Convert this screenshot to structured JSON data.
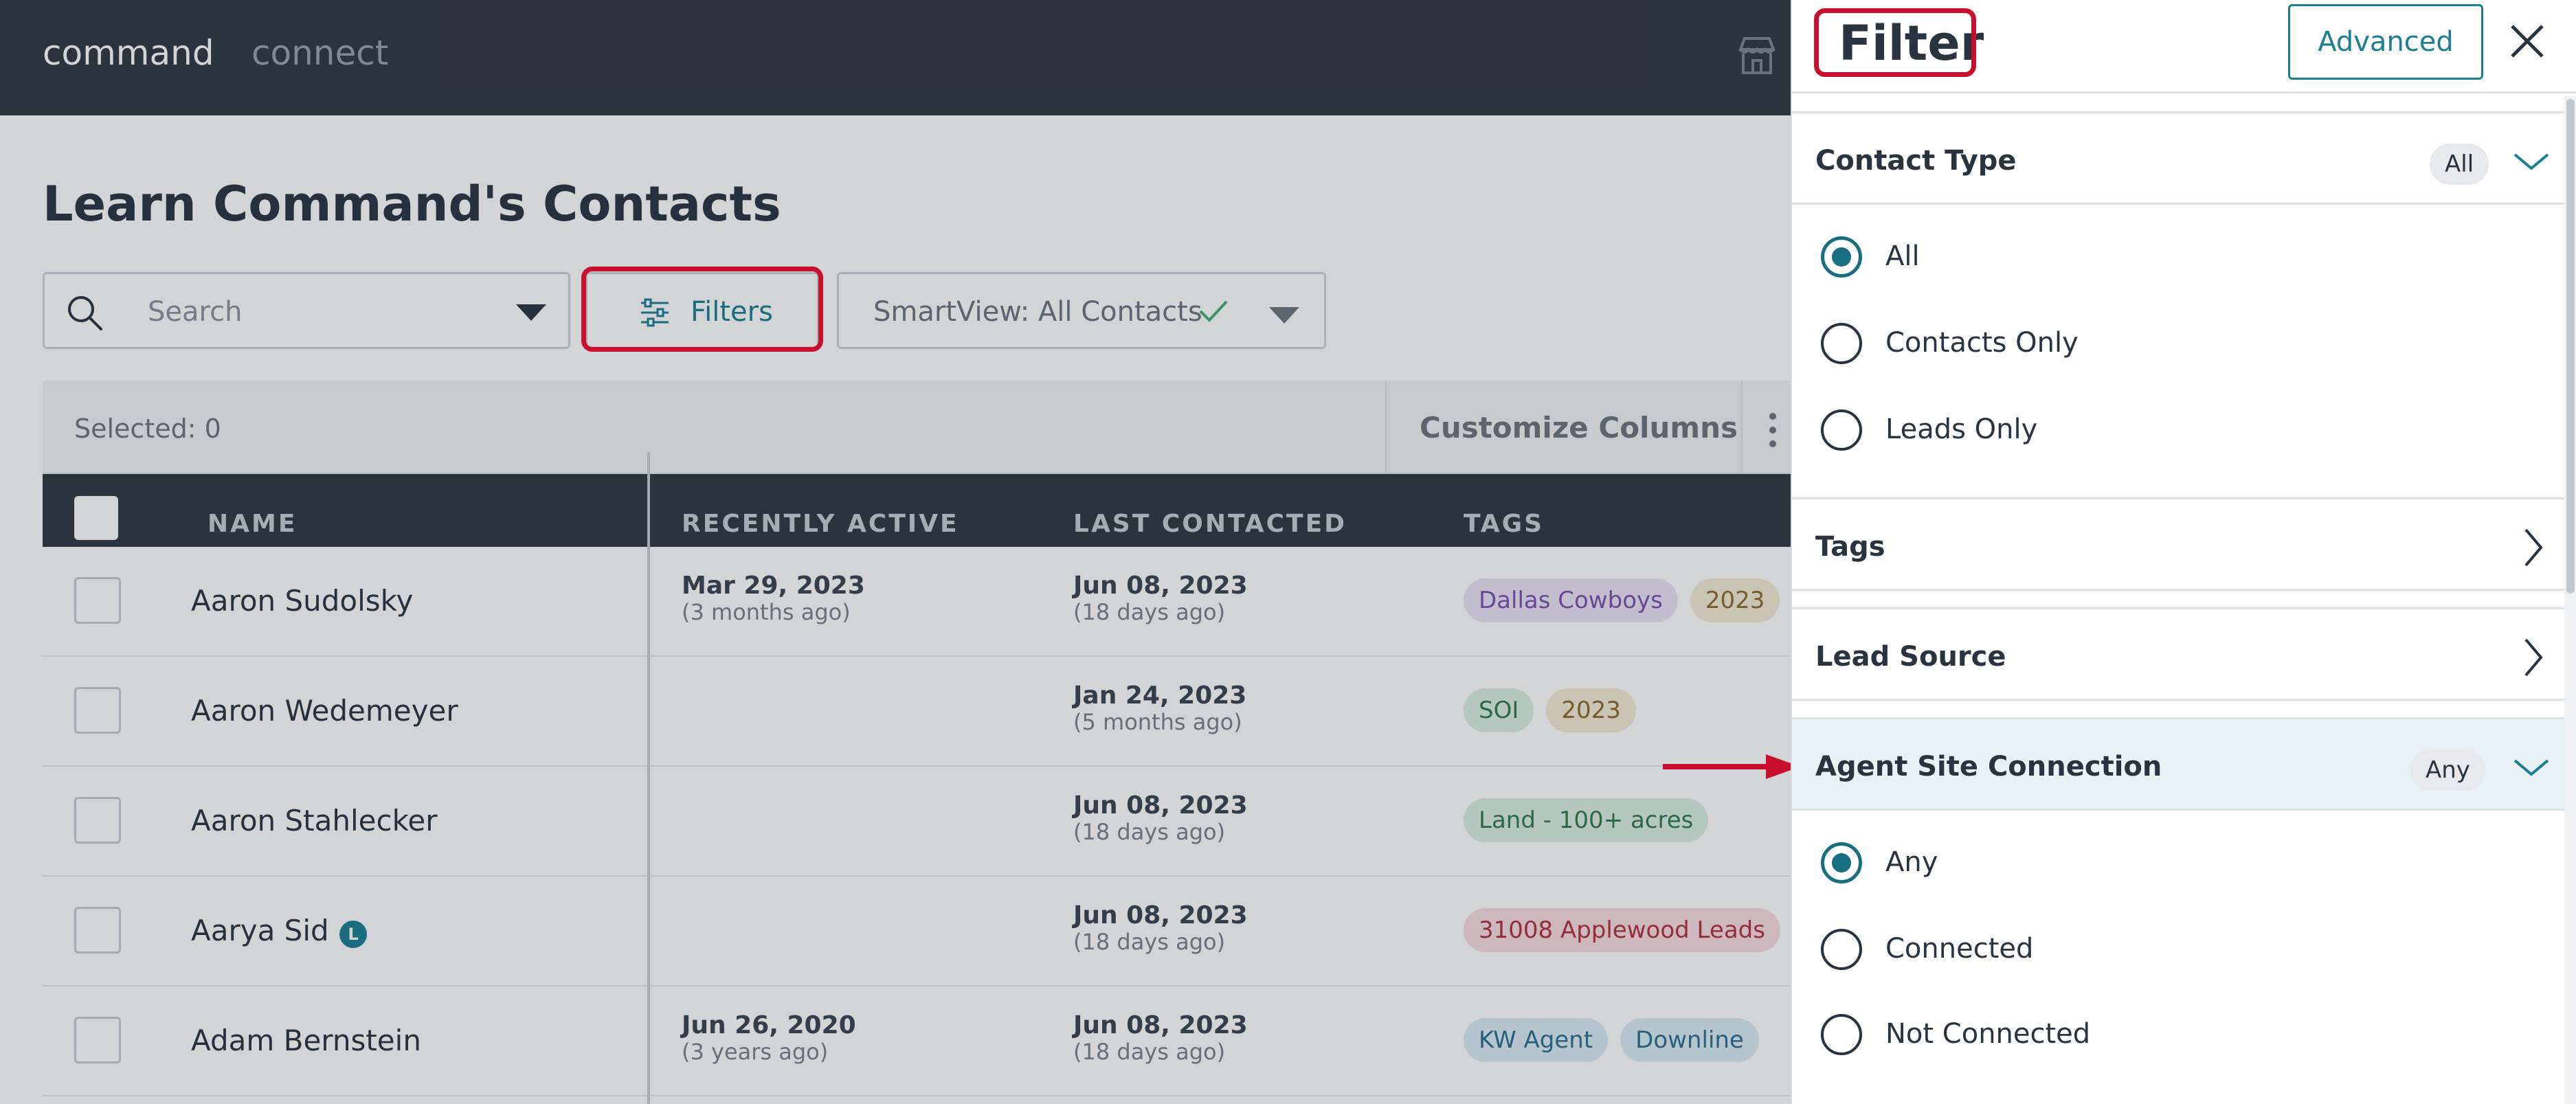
{
  "app": {
    "nav": {
      "command": "command",
      "connect": "connect"
    },
    "page_title": "Learn Command's Contacts",
    "search": {
      "placeholder": "Search"
    },
    "filters_button": "Filters",
    "smartview": "SmartView: All Contacts",
    "selected": "Selected: 0",
    "customize_columns": "Customize Columns",
    "columns": [
      "NAME",
      "RECENTLY ACTIVE",
      "LAST CONTACTED",
      "TAGS"
    ],
    "rows": [
      {
        "name": "Aaron Sudolsky",
        "lead": "",
        "recent_date": "Mar 29, 2023",
        "recent_ago": "(3 months ago)",
        "last_date": "Jun 08, 2023",
        "last_ago": "(18 days ago)",
        "tags": [
          {
            "text": "Dallas Cowboys",
            "bg": "#ece4f6",
            "fg": "#7b4fb0"
          },
          {
            "text": "2023",
            "bg": "#f6ecd6",
            "fg": "#8a6a2a"
          }
        ]
      },
      {
        "name": "Aaron Wedemeyer",
        "lead": "",
        "recent_date": "",
        "recent_ago": "",
        "last_date": "Jan 24, 2023",
        "last_ago": "(5 months ago)",
        "tags": [
          {
            "text": "SOI",
            "bg": "#dcefe3",
            "fg": "#2f7a4a"
          },
          {
            "text": "2023",
            "bg": "#f6ecd6",
            "fg": "#8a6a2a"
          }
        ]
      },
      {
        "name": "Aaron Stahlecker",
        "lead": "",
        "recent_date": "",
        "recent_ago": "",
        "last_date": "Jun 08, 2023",
        "last_ago": "(18 days ago)",
        "tags": [
          {
            "text": "Land - 100+ acres",
            "bg": "#dcefe3",
            "fg": "#2f7a4a"
          }
        ]
      },
      {
        "name": "Aarya Sid",
        "lead": "L",
        "recent_date": "",
        "recent_ago": "",
        "last_date": "Jun 08, 2023",
        "last_ago": "(18 days ago)",
        "tags": [
          {
            "text": "31008 Applewood Leads",
            "bg": "#f8dde0",
            "fg": "#b3303d"
          }
        ]
      },
      {
        "name": "Adam Bernstein",
        "lead": "",
        "recent_date": "Jun 26, 2020",
        "recent_ago": "(3 years ago)",
        "last_date": "Jun 08, 2023",
        "last_ago": "(18 days ago)",
        "tags": [
          {
            "text": "KW Agent",
            "bg": "#dcecf4",
            "fg": "#2a6f8e"
          },
          {
            "text": "Downline",
            "bg": "#dcecf4",
            "fg": "#2a6f8e"
          }
        ]
      }
    ]
  },
  "filter_panel": {
    "title": "Filter",
    "advanced": "Advanced",
    "sections": {
      "contact_type": {
        "title": "Contact Type",
        "badge": "All",
        "options": [
          "All",
          "Contacts Only",
          "Leads Only"
        ],
        "selected": 0
      },
      "tags": {
        "title": "Tags"
      },
      "lead_source": {
        "title": "Lead Source"
      },
      "agent_site": {
        "title": "Agent Site Connection",
        "badge": "Any",
        "options": [
          "Any",
          "Connected",
          "Not Connected"
        ],
        "selected": 0
      }
    }
  },
  "colors": {
    "accent": "#1a7f92",
    "annotation": "#c8102e",
    "topbar": "#2f3640"
  },
  "icons": [
    "store-icon",
    "search-icon",
    "chevron-down-icon",
    "sliders-icon",
    "check-icon",
    "kebab-icon",
    "close-icon",
    "chevron-right-icon",
    "arrow-right-icon"
  ]
}
